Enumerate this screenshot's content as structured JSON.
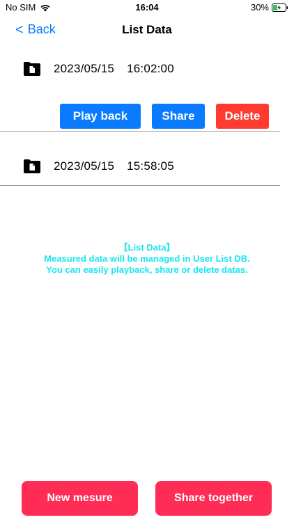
{
  "status_bar": {
    "carrier": "No SIM",
    "time": "16:04",
    "battery": "30%"
  },
  "nav": {
    "back_label": "Back",
    "back_chevron": "<",
    "title": "List Data"
  },
  "items": [
    {
      "date": "2023/05/15",
      "time": "16:02:00",
      "icon": "folder-icon"
    },
    {
      "date": "2023/05/15",
      "time": "15:58:05",
      "icon": "folder-icon"
    }
  ],
  "actions": {
    "play_back": "Play back",
    "share": "Share",
    "delete": "Delete"
  },
  "info": {
    "line1": "【List Data】",
    "line2": "Measured data will be managed in User List DB.",
    "line3": "You can easily playback, share or delete datas."
  },
  "bottom": {
    "new_mesure": "New mesure",
    "share_together": "Share together"
  },
  "colors": {
    "accent_blue": "#0a7aff",
    "delete_red": "#ff3b30",
    "bottom_pink": "#ff2d55",
    "info_cyan": "#19e6f0"
  }
}
